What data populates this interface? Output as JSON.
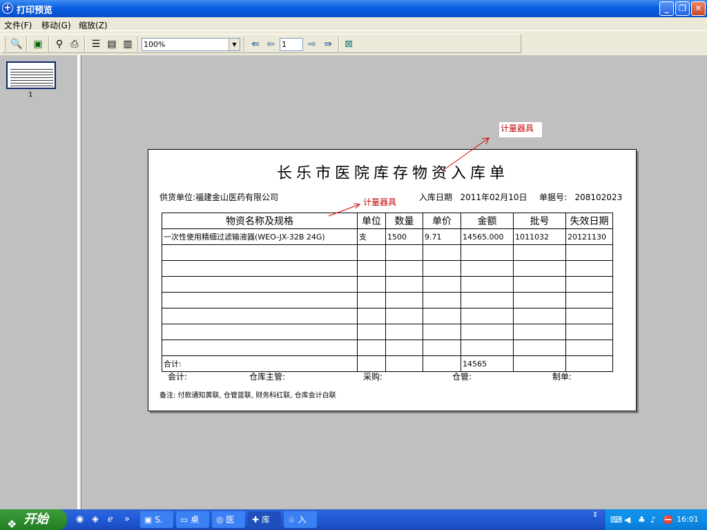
{
  "window": {
    "title": "打印预览"
  },
  "menu": [
    "文件(F)",
    "移动(G)",
    "缩放(Z)"
  ],
  "toolbar": {
    "zoom_value": "100%",
    "page_value": "1",
    "buttons": [
      "search-icon",
      "save-icon",
      "find-icon",
      "print-icon",
      "single-page-icon",
      "two-page-icon",
      "multi-page-icon",
      "first-page-icon",
      "prev-page-icon",
      "next-page-icon",
      "last-page-icon",
      "close-preview-icon"
    ]
  },
  "thumbnail": {
    "page_number": "1"
  },
  "document": {
    "title": "长乐市医院库存物资入库单",
    "supplier_label": "供货单位:",
    "supplier": "福建金山医药有限公司",
    "date_label": "入库日期",
    "date_value": "2011年02月10日",
    "docno_label": "单据号:",
    "docno_value": "208102023",
    "headers": [
      "物资名称及规格",
      "单位",
      "数量",
      "单价",
      "金额",
      "批号",
      "失效日期"
    ],
    "rows": [
      [
        "一次性使用精细过滤输液器(WEO-JX-32B 24G)",
        "支",
        "1500",
        "9.71",
        "14565.000",
        "1011032",
        "20121130"
      ]
    ],
    "total_label": "合计:",
    "total_amount": "14565",
    "signatures": [
      "会计:",
      "仓库主管:",
      "采购:",
      "仓管:",
      "制单:"
    ],
    "remark": "备注: 付款通知黄联, 仓管蓝联, 财务科红联, 仓库会计白联"
  },
  "annotations": [
    "计量器具",
    "计量器具"
  ],
  "taskbar": {
    "start_label": "开始",
    "tasks": [
      "S.",
      "桌",
      "医",
      "库",
      "入"
    ],
    "clock": "16:01"
  }
}
